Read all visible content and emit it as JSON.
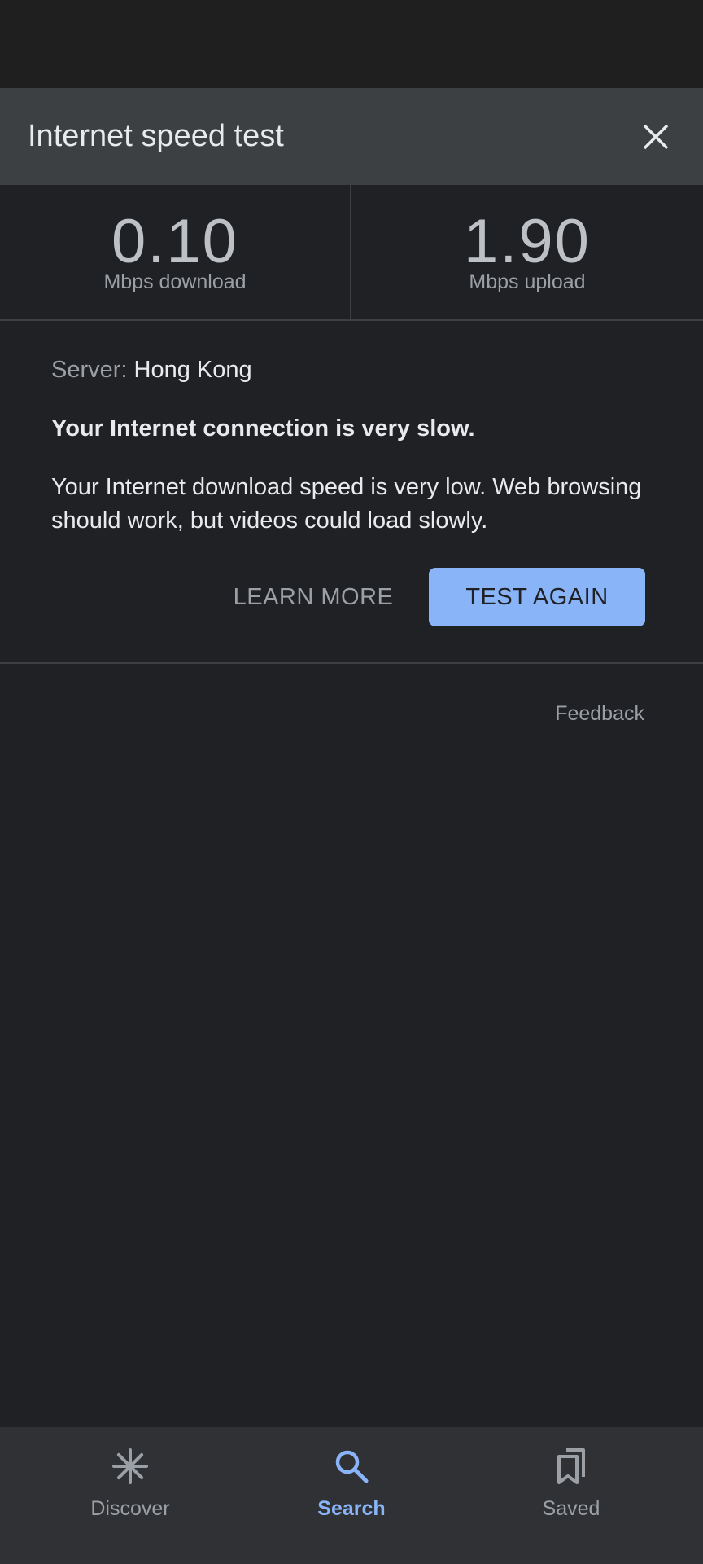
{
  "header": {
    "title": "Internet speed test"
  },
  "speeds": {
    "download": {
      "value": "0.10",
      "unit": "Mbps download"
    },
    "upload": {
      "value": "1.90",
      "unit": "Mbps upload"
    }
  },
  "result": {
    "server_label": "Server:",
    "server_value": "Hong Kong",
    "headline": "Your Internet connection is very slow.",
    "description": "Your Internet download speed is very low. Web browsing should work, but videos could load slowly."
  },
  "actions": {
    "learn_more": "LEARN MORE",
    "test_again": "TEST AGAIN"
  },
  "feedback": "Feedback",
  "bottom_nav": {
    "items": [
      {
        "label": "Discover",
        "icon": "asterisk-icon",
        "active": false
      },
      {
        "label": "Search",
        "icon": "search-icon",
        "active": true
      },
      {
        "label": "Saved",
        "icon": "bookmarks-icon",
        "active": false
      }
    ]
  },
  "colors": {
    "background": "#202124",
    "header": "#3c4043",
    "accent": "#8ab4f8",
    "text_primary": "#e8eaed",
    "text_secondary": "#9aa0a6"
  }
}
